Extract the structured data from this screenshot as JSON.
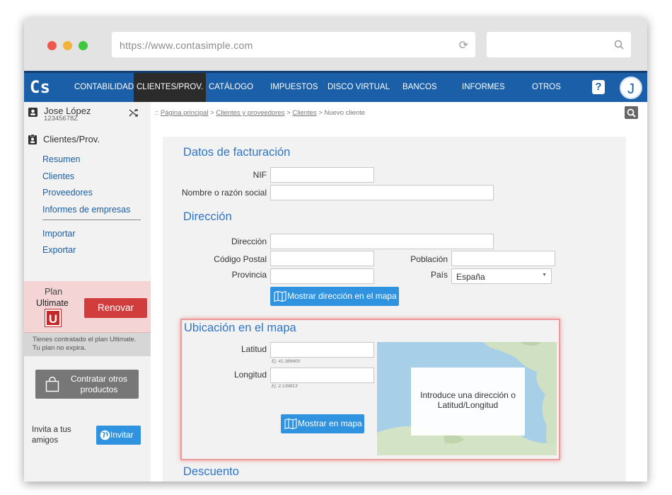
{
  "browser": {
    "url": "https://www.contasimple.com"
  },
  "nav": {
    "logo": "Cs",
    "items": [
      "CONTABILIDAD",
      "CLIENTES/PROV.",
      "CATÁLOGO",
      "IMPUESTOS",
      "DISCO VIRTUAL",
      "BANCOS",
      "INFORMES",
      "OTROS"
    ],
    "active": "CLIENTES/PROV.",
    "help": "?",
    "avatar": "J"
  },
  "user": {
    "name": "Jose López",
    "id": "12345678Z"
  },
  "sidebar": {
    "section": "Clientes/Prov.",
    "links": [
      "Resumen",
      "Clientes",
      "Proveedores",
      "Informes de empresas"
    ],
    "links2": [
      "Importar",
      "Exportar"
    ]
  },
  "plan": {
    "label": "Plan",
    "name": "Ultimate",
    "badge": "U",
    "renew_label": "Renovar",
    "info_line1": "Tienes contratado el plan Ultimate.",
    "info_line2": "Tu plan no expira."
  },
  "contratar": {
    "line1": "Contratar otros",
    "line2": "productos"
  },
  "invite": {
    "line1": "Invita a tus",
    "line2": "amigos",
    "button": "Invitar"
  },
  "breadcrumb": {
    "prefix": ":: ",
    "items": [
      "Página principal",
      "Clientes y proveedores",
      "Clientes"
    ],
    "current": "Nuevo cliente",
    "sep": " > "
  },
  "form": {
    "billing_title": "Datos de facturación",
    "nif_label": "NIF",
    "name_label": "Nombre o razón social",
    "address_title": "Dirección",
    "address_label": "Dirección",
    "postal_label": "Código Postal",
    "city_label": "Población",
    "province_label": "Provincia",
    "country_label": "País",
    "country_value": "España",
    "show_address_btn": "Mostrar dirección en el mapa",
    "map_title": "Ubicación en el mapa",
    "lat_label": "Latitud",
    "lat_hint": "Ej: 41.389400",
    "lon_label": "Longitud",
    "lon_hint": "Ej: 2.139813",
    "show_map_btn": "Mostrar en mapa",
    "map_msg_line1": "Introduce una dirección o",
    "map_msg_line2": "Latitud/Longitud",
    "discount_title": "Descuento"
  },
  "colors": {
    "nav": "#1b5fa8",
    "accent": "#2e75c7",
    "button": "#2f93e0",
    "renew": "#d13d3d"
  }
}
